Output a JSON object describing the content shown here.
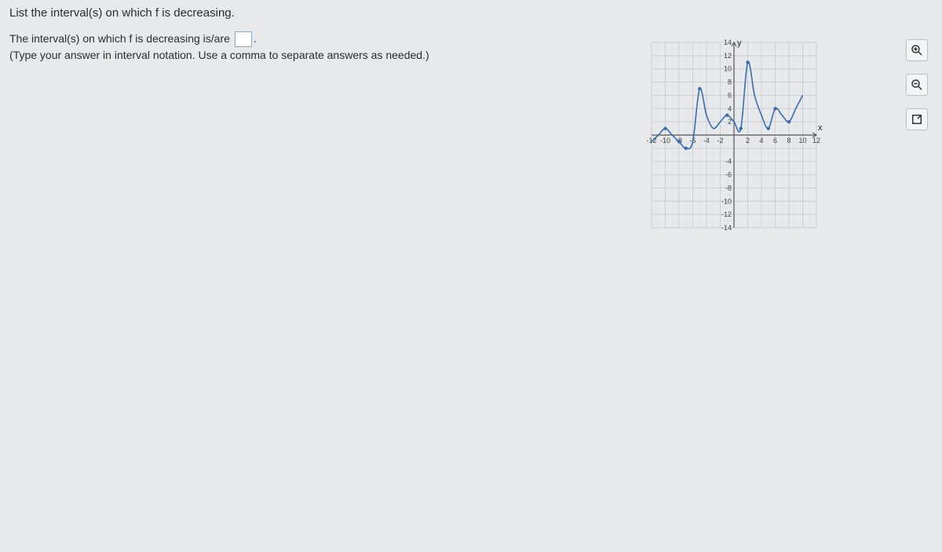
{
  "question": {
    "title": "List the interval(s) on which f is decreasing.",
    "prefix": "The interval(s) on which f is decreasing is/are ",
    "suffix": ".",
    "hint": "(Type your answer in interval notation. Use a comma to separate answers as needed.)"
  },
  "tools": {
    "zoom_in": "zoom-in",
    "zoom_out": "zoom-out",
    "expand": "expand"
  },
  "chart_data": {
    "type": "line",
    "xlabel": "x",
    "ylabel": "y",
    "xlim": [
      -12,
      12
    ],
    "ylim": [
      -14,
      14
    ],
    "xticks": [
      -12,
      -10,
      -8,
      -6,
      -4,
      -2,
      2,
      4,
      6,
      8,
      10,
      12
    ],
    "xtick_labels": [
      "-12",
      "-10",
      "-8",
      "-6",
      "-4",
      "-2",
      "2",
      "4",
      "6",
      "8",
      "10",
      "12"
    ],
    "yticks": [
      -14,
      -12,
      -10,
      -8,
      -6,
      -4,
      2,
      4,
      6,
      8,
      10,
      12,
      14
    ],
    "ytick_labels": [
      "-14",
      "-12",
      "-10",
      "-8",
      "-6",
      "-4",
      "2",
      "4",
      "6",
      "8",
      "10",
      "12",
      "14"
    ],
    "series": [
      {
        "name": "f",
        "values": [
          {
            "x": -12,
            "y": -1
          },
          {
            "x": -11,
            "y": 0
          },
          {
            "x": -10,
            "y": 1
          },
          {
            "x": -9,
            "y": 0
          },
          {
            "x": -8,
            "y": -1
          },
          {
            "x": -7,
            "y": -2
          },
          {
            "x": -6,
            "y": -1
          },
          {
            "x": -5,
            "y": 7
          },
          {
            "x": -4,
            "y": 3
          },
          {
            "x": -3,
            "y": 1
          },
          {
            "x": -2,
            "y": 2
          },
          {
            "x": -1,
            "y": 3
          },
          {
            "x": 0,
            "y": 2
          },
          {
            "x": 1,
            "y": 1
          },
          {
            "x": 2,
            "y": 11
          },
          {
            "x": 3,
            "y": 6
          },
          {
            "x": 4,
            "y": 3
          },
          {
            "x": 5,
            "y": 1
          },
          {
            "x": 6,
            "y": 4
          },
          {
            "x": 7,
            "y": 3
          },
          {
            "x": 8,
            "y": 2
          },
          {
            "x": 9,
            "y": 4
          },
          {
            "x": 10,
            "y": 6
          }
        ]
      }
    ],
    "marked_points": [
      {
        "x": -10,
        "y": 1
      },
      {
        "x": -8,
        "y": -1
      },
      {
        "x": -7,
        "y": -2
      },
      {
        "x": -5,
        "y": 7
      },
      {
        "x": -1,
        "y": 3
      },
      {
        "x": 1,
        "y": 1
      },
      {
        "x": 2,
        "y": 11
      },
      {
        "x": 5,
        "y": 1
      },
      {
        "x": 6,
        "y": 4
      },
      {
        "x": 8,
        "y": 2
      }
    ]
  }
}
